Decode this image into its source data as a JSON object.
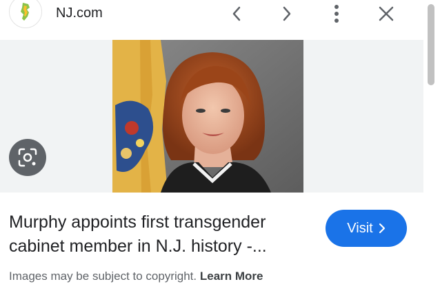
{
  "header": {
    "site_name": "NJ.com",
    "favicon_icon": "new-jersey-map-icon",
    "back_icon": "chevron-left-icon",
    "forward_icon": "chevron-right-icon",
    "more_icon": "more-vert-icon",
    "close_icon": "close-icon"
  },
  "image": {
    "lens_icon": "google-lens-icon"
  },
  "result": {
    "title": "Murphy appoints first transgender cabinet member in N.J. history -...",
    "visit_label": "Visit",
    "visit_icon": "chevron-right-icon"
  },
  "footer": {
    "copyright_text": "Images may be subject to copyright.",
    "learn_more": "Learn More"
  },
  "colors": {
    "accent": "#1a73e8",
    "background": "#f1f3f4",
    "text": "#202124"
  }
}
